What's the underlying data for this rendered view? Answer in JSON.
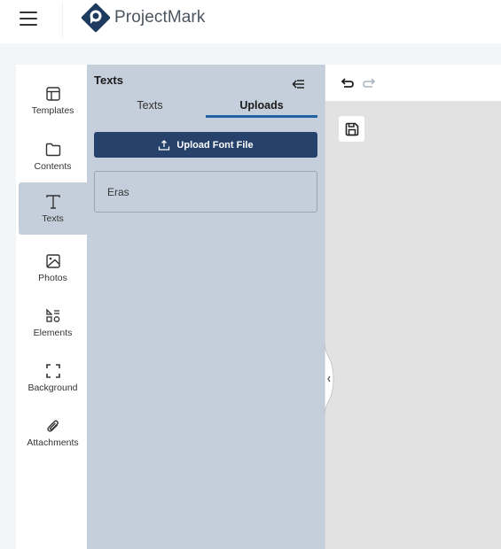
{
  "header": {
    "brand": "ProjectMark",
    "brand_color": "#1f3a5f",
    "menu_icon": "hamburger-icon"
  },
  "sidebar": {
    "items": [
      {
        "label": "Templates",
        "icon": "layout-icon",
        "active": false
      },
      {
        "label": "Contents",
        "icon": "folder-icon",
        "active": false
      },
      {
        "label": "Texts",
        "icon": "text-icon",
        "active": true
      },
      {
        "label": "Photos",
        "icon": "image-icon",
        "active": false
      },
      {
        "label": "Elements",
        "icon": "shapes-icon",
        "active": false
      },
      {
        "label": "Background",
        "icon": "frame-icon",
        "active": false
      },
      {
        "label": "Attachments",
        "icon": "paperclip-icon",
        "active": false
      }
    ]
  },
  "panel": {
    "title": "Texts",
    "tabs": [
      {
        "label": "Texts",
        "active": false
      },
      {
        "label": "Uploads",
        "active": true
      }
    ],
    "upload_button": "Upload Font File",
    "fonts": [
      "Eras"
    ],
    "accent": "#2063a0",
    "button_color": "#26426a"
  },
  "canvas": {
    "undo_icon": "undo-icon",
    "redo_icon": "redo-icon",
    "save_icon": "save-icon"
  }
}
